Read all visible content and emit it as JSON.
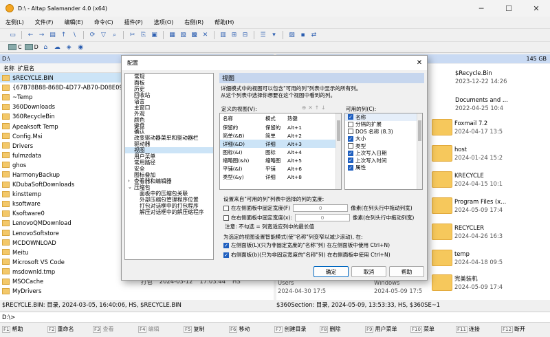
{
  "window": {
    "title": "D:\\ - Altap Salamander 4.0 (x64)"
  },
  "menu": [
    "左侧(L)",
    "文件(F)",
    "编辑(E)",
    "命令(C)",
    "插件(P)",
    "选项(O)",
    "右侧(R)",
    "帮助(H)"
  ],
  "drives": [
    {
      "label": "C"
    },
    {
      "label": "D"
    }
  ],
  "left_path": "D:\\",
  "right_free": "145 GB",
  "columns": {
    "name": "名称",
    "ext": "扩展名"
  },
  "left_files": [
    "$RECYCLE.BIN",
    "{67B78B88-868D-4D77-AB70-D08E09536",
    "~Temp",
    "360Downloads",
    "360RecycleBin",
    "Apeaksoft Temp",
    "Config.Msi",
    "Drivers",
    "fulmzdata",
    "ghos",
    "HarmonyBackup",
    "KDubaSoftDownloads",
    "kinsttemp",
    "ksoftware",
    "Ksoftware0",
    "LenovoQMDownload",
    "LenovoSoftstore",
    "MCDOWNLOAD",
    "Meitu",
    "Microsoft VS Code",
    "msdownld.tmp",
    "MSOCache",
    "MyDrivers"
  ],
  "right_tiles": [
    {
      "name": "$Recycle.Bin",
      "date": "2023-12-22 14:26"
    },
    {
      "name": "Documents and ...",
      "date": "2022-04-25 10:4"
    },
    {
      "name": "Foxmail 7.2",
      "date": "2024-04-17 13:5"
    },
    {
      "name": "host",
      "date": "2024-01-24 15:2"
    },
    {
      "name": "KRECYCLE",
      "date": "2024-04-15 10:1"
    },
    {
      "name": "Program Files (x...",
      "date": "2024-05-09 17:4"
    },
    {
      "name": "RECYCLER",
      "date": "2024-04-26 16:3"
    },
    {
      "name": "temp",
      "date": "2024-04-18 09:5"
    },
    {
      "name": "完美装机",
      "date": "2024-05-09 17:4"
    }
  ],
  "behind_text": {
    "left_row_a": "打包",
    "left_row_b": "2024-03-12",
    "left_row_c": "17:03:44",
    "left_row_d": "HS",
    "right_users": "Users",
    "right_users_date": "2024-04-30 17:5",
    "right_windows": "Windows",
    "right_windows_date": "2024-05-09 17:5"
  },
  "status": {
    "left": "$RECYCLE.BIN: 目录, 2024-03-05, 16:40:06, HS, $RECYCLE.BIN",
    "right": "$360Section: 目录, 2024-05-09, 13:53:33, HS, $360SE~1"
  },
  "cmdline": "D:\\>",
  "fkeys": [
    {
      "key": "F1",
      "label": "帮助"
    },
    {
      "key": "F2",
      "label": "重命名"
    },
    {
      "key": "F3",
      "label": "查看"
    },
    {
      "key": "F4",
      "label": "编辑"
    },
    {
      "key": "F5",
      "label": "复制"
    },
    {
      "key": "F6",
      "label": "移动"
    },
    {
      "key": "F7",
      "label": "创建目录"
    },
    {
      "key": "F8",
      "label": "删除"
    },
    {
      "key": "F9",
      "label": "用户菜单"
    },
    {
      "key": "F10",
      "label": "菜单"
    },
    {
      "key": "F11",
      "label": "连接"
    },
    {
      "key": "F12",
      "label": "断开"
    }
  ],
  "dialog": {
    "title": "配置",
    "tree": [
      {
        "label": "常规",
        "child": false
      },
      {
        "label": "面板",
        "child": false
      },
      {
        "label": "历史",
        "child": false
      },
      {
        "label": "回收站",
        "child": false
      },
      {
        "label": "语言",
        "child": false
      },
      {
        "label": "主窗口",
        "child": false
      },
      {
        "label": "外观",
        "child": false
      },
      {
        "label": "颜色",
        "child": false
      },
      {
        "label": "键盘",
        "child": false
      },
      {
        "label": "确认",
        "child": false
      },
      {
        "label": "改变驱动器菜单和驱动器栏",
        "child": false
      },
      {
        "label": "驱动器",
        "child": false
      },
      {
        "label": "视图",
        "child": false,
        "selected": true
      },
      {
        "label": "用户菜单",
        "child": false
      },
      {
        "label": "常用路径",
        "child": false
      },
      {
        "label": "安全",
        "child": false
      },
      {
        "label": "图标叠加",
        "child": false
      },
      {
        "label": "查看器和编辑器",
        "child": false,
        "expander": ">"
      },
      {
        "label": "压缩包",
        "child": false,
        "expander": "∨"
      },
      {
        "label": "面板中的压缩包关联",
        "child": true
      },
      {
        "label": "外部压缩包管理程序位置",
        "child": true
      },
      {
        "label": "打包对话框中的打包程序",
        "child": true
      },
      {
        "label": "解压对话框中的解压缩程序",
        "child": true
      }
    ],
    "section_title": "视图",
    "desc_line1": "详细模式中的视图可以包含\"可用的列\"列表中显示的所有列。",
    "desc_line2": "从这个列表中选择你想要在这个视图中看到的列。",
    "defined_label": "定义的视图(V):",
    "available_label": "可用的列(C):",
    "views_header": {
      "name": "名称",
      "mode": "模式",
      "hotkey": "热键"
    },
    "views": [
      {
        "name": "保留的",
        "mode": "保留的",
        "hotkey": "Alt+1"
      },
      {
        "name": "简单(&B)",
        "mode": "简单",
        "hotkey": "Alt+2"
      },
      {
        "name": "详细(&D)",
        "mode": "详细",
        "hotkey": "Alt+3"
      },
      {
        "name": "图标(&I)",
        "mode": "图标",
        "hotkey": "Alt+4"
      },
      {
        "name": "缩略图(&h)",
        "mode": "缩略图",
        "hotkey": "Alt+5"
      },
      {
        "name": "平铺(&l)",
        "mode": "平铺",
        "hotkey": "Alt+6"
      },
      {
        "name": "类型(&y)",
        "mode": "详细",
        "hotkey": "Alt+8"
      }
    ],
    "available": [
      {
        "label": "名称",
        "checked": true
      },
      {
        "label": "分隔的扩展",
        "checked": false
      },
      {
        "label": "DOS 名称 (8.3)",
        "checked": false
      },
      {
        "label": "大小",
        "checked": true
      },
      {
        "label": "类型",
        "checked": false
      },
      {
        "label": "上次写入日期",
        "checked": true
      },
      {
        "label": "上次写入时间",
        "checked": true
      },
      {
        "label": "属性",
        "checked": true
      }
    ],
    "width_title": "设置来自\"可用的列\"列表中选择的列的宽度:",
    "width_rows": [
      {
        "label": "在左侧面板中固定宽度(F)",
        "value": "0",
        "hint": "像素(在列头行中拖动列宽)"
      },
      {
        "label": "在右侧面板中固定宽度(x):",
        "value": "0",
        "hint": "像素(在列头行中拖动列宽)"
      }
    ],
    "note": "注意: 不勾选 = 列宽适应列中的最长值",
    "smart_title": "为选定的视图设置智能模式(使\"名称\"列变窄以减少滚动), 在:",
    "smart_rows": [
      "左侧面板(L)(只为非固定宽度的\"名称\"列)  在左侧面板中使用 Ctrl+N)",
      "右侧面板(b)(只为非固定宽度的\"名称\"列)  在右侧面板中使用 Ctrl+N)"
    ],
    "buttons": {
      "ok": "确定",
      "cancel": "取消",
      "help": "帮助"
    }
  }
}
